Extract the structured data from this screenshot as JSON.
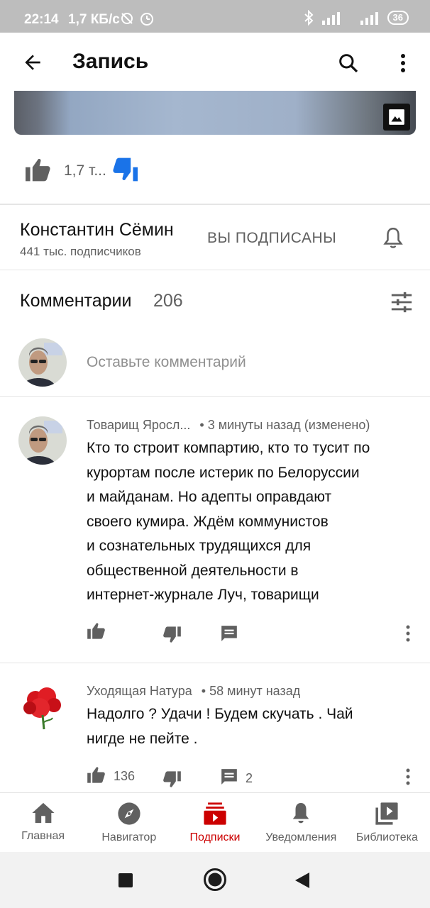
{
  "status": {
    "time": "22:14",
    "net": "1,7 КБ/с",
    "battery": "36"
  },
  "appbar": {
    "title": "Запись",
    "icons": [
      "arrow-back-icon",
      "search-icon",
      "more-vert-icon"
    ]
  },
  "post": {
    "like_count": "1,7 т..."
  },
  "channel": {
    "name": "Константин Сёмин",
    "subscribers": "441 тыс. подписчиков",
    "subscribe_label": "ВЫ ПОДПИСАНЫ"
  },
  "comments": {
    "title": "Комментарии",
    "count": "206",
    "placeholder": "Оставьте комментарий",
    "items": [
      {
        "author": "Товарищ Яросл...",
        "time": "• 3 минуты назад (изменено)",
        "lines": [
          "Кто то строит компартию, кто то тусит по",
          "курортам после истерик по Белоруссии",
          "и майданам. Но адепты оправдают",
          "своего кумира. Ждём коммунистов",
          "и сознательных трудящихся для",
          "общественной деятельности в",
          "интернет-журнале Луч, товарищи"
        ],
        "likes": "",
        "replies": ""
      },
      {
        "author": "Уходящая Натура",
        "time": "• 58 минут назад",
        "lines": [
          "Надолго ? Удачи ! Будем скучать . Чай",
          "нигде не пейте ."
        ],
        "likes": "136",
        "replies": "2"
      }
    ]
  },
  "bottom_nav": {
    "active_color": "#cc0000",
    "items": [
      {
        "label": "Главная",
        "icon": "home-icon"
      },
      {
        "label": "Навигатор",
        "icon": "compass-icon"
      },
      {
        "label": "Подписки",
        "icon": "subscriptions-icon"
      },
      {
        "label": "Уведомления",
        "icon": "bell-icon"
      },
      {
        "label": "Библиотека",
        "icon": "library-icon"
      }
    ]
  }
}
